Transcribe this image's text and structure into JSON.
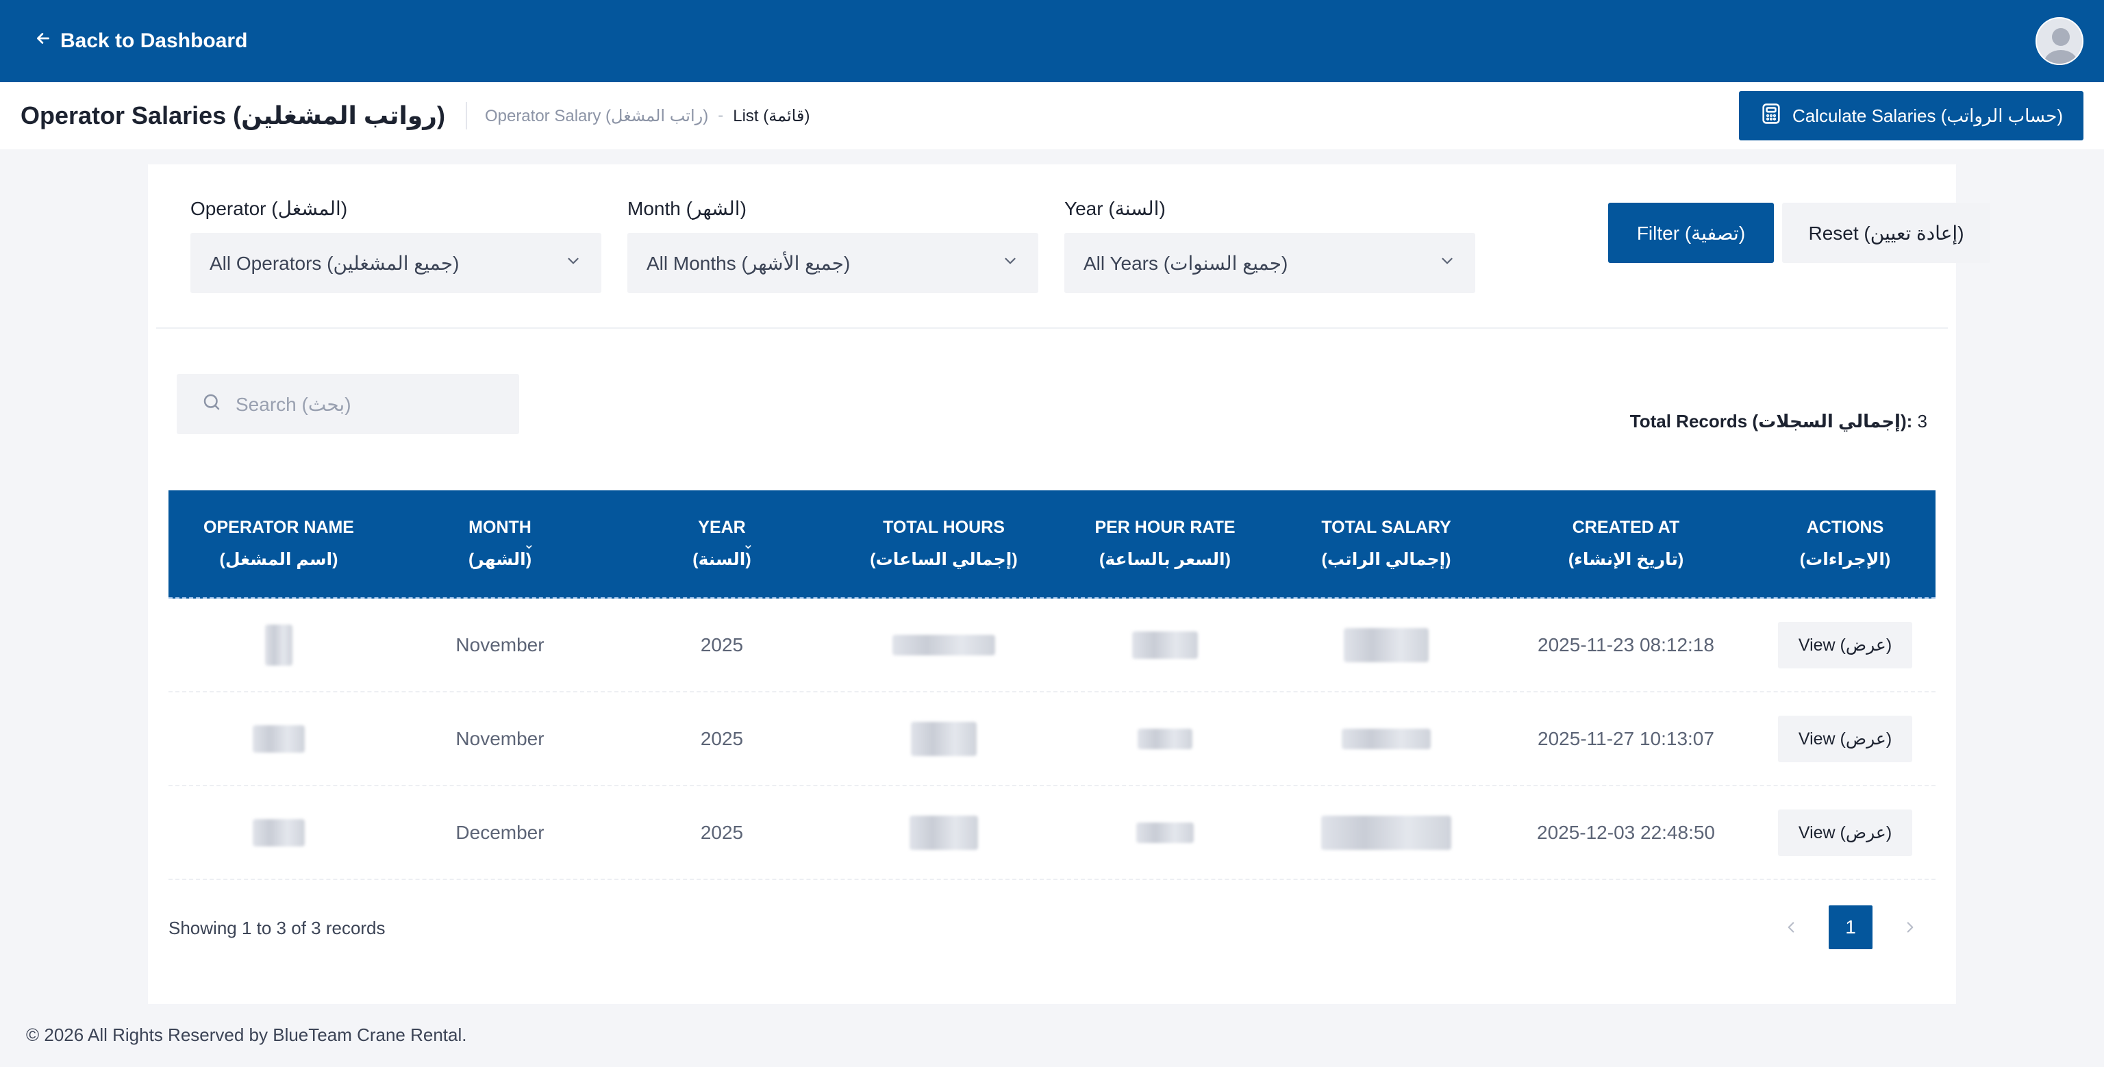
{
  "topbar": {
    "back_label": "Back to Dashboard"
  },
  "header": {
    "title": "Operator Salaries (رواتب المشغلين)",
    "breadcrumb": [
      "Operator Salary (راتب المشغل)",
      "List (قائمة)"
    ],
    "calculate_label": "Calculate Salaries (حساب الرواتب)"
  },
  "filters": {
    "operator": {
      "label": "Operator (المشغل)",
      "value": "All Operators (جميع المشغلين)"
    },
    "month": {
      "label": "Month (الشهر)",
      "value": "All Months (جميع الأشهر)"
    },
    "year": {
      "label": "Year (السنة)",
      "value": "All Years (جميع السنوات)"
    },
    "filter_label": "Filter (تصفية)",
    "reset_label": "Reset (إعادة تعيين)"
  },
  "search": {
    "placeholder": "Search (بحث)"
  },
  "total_records": {
    "label": "Total Records (إجمالي السجلات):",
    "value": "3"
  },
  "table": {
    "columns": [
      {
        "en": "OPERATOR NAME",
        "ar": "(اسم المشغل)"
      },
      {
        "en": "MONTH",
        "ar": "(الشهر)"
      },
      {
        "en": "YEAR",
        "ar": "(السنة)"
      },
      {
        "en": "TOTAL HOURS",
        "ar": "(إجمالي الساعات)"
      },
      {
        "en": "PER HOUR RATE",
        "ar": "(السعر بالساعة)"
      },
      {
        "en": "TOTAL SALARY",
        "ar": "(إجمالي الراتب)"
      },
      {
        "en": "CREATED AT",
        "ar": "(تاريخ الإنشاء)"
      },
      {
        "en": "ACTIONS",
        "ar": "(الإجراءات)"
      }
    ],
    "rows": [
      {
        "month": "November",
        "year": "2025",
        "created_at": "2025-11-23 08:12:18",
        "action": "View (عرض)"
      },
      {
        "month": "November",
        "year": "2025",
        "created_at": "2025-11-27 10:13:07",
        "action": "View (عرض)"
      },
      {
        "month": "December",
        "year": "2025",
        "created_at": "2025-12-03 22:48:50",
        "action": "View (عرض)"
      }
    ]
  },
  "pagination": {
    "showing": "Showing 1 to 3 of 3 records",
    "current_page": "1"
  },
  "footer": {
    "text": "© 2026 All Rights Reserved by BlueTeam Crane Rental."
  },
  "colors": {
    "primary": "#04569c",
    "background": "#f4f5f8"
  }
}
